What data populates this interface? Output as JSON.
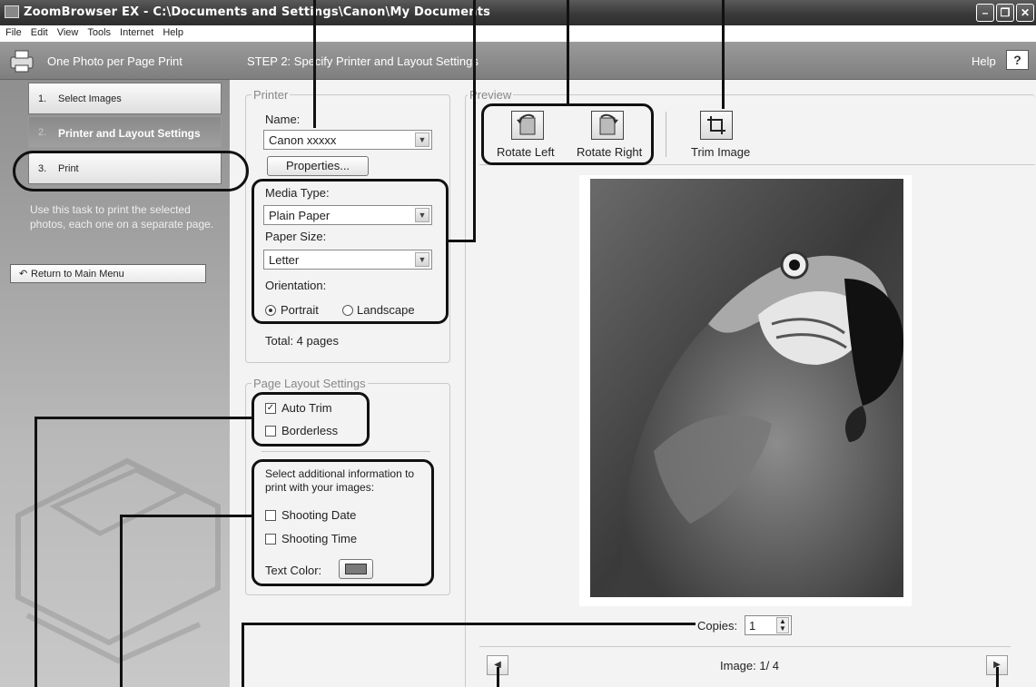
{
  "window": {
    "title": "ZoomBrowser EX  -  C:\\Documents and Settings\\Canon\\My Documents",
    "buttons": [
      "minimize",
      "restore",
      "close"
    ]
  },
  "menu": [
    "File",
    "Edit",
    "View",
    "Tools",
    "Internet",
    "Help"
  ],
  "header": {
    "task_title": "One Photo per Page Print",
    "step_title": "STEP 2: Specify Printer and Layout Settings",
    "help_label": "Help",
    "help_button": "?"
  },
  "sidebar": {
    "steps": [
      {
        "num": "1.",
        "label": "Select Images"
      },
      {
        "num": "2.",
        "label": "Printer and Layout Settings"
      },
      {
        "num": "3.",
        "label": "Print"
      }
    ],
    "description": "Use this task to print the selected photos, each one on a separate page.",
    "return_label": "Return to Main Menu"
  },
  "printer": {
    "legend": "Printer",
    "name_label": "Name:",
    "name_value": "Canon xxxxx",
    "properties_label": "Properties...",
    "media_label": "Media Type:",
    "media_value": "Plain Paper",
    "size_label": "Paper Size:",
    "size_value": "Letter",
    "orientation_label": "Orientation:",
    "portrait_label": "Portrait",
    "landscape_label": "Landscape",
    "orientation_selected": "Portrait",
    "total": "Total: 4 pages"
  },
  "layout": {
    "legend": "Page Layout Settings",
    "auto_trim_label": "Auto Trim",
    "auto_trim_checked": true,
    "borderless_label": "Borderless",
    "borderless_checked": false,
    "additional_info": "Select additional information to print with your images:",
    "shooting_date_label": "Shooting Date",
    "shooting_time_label": "Shooting Time",
    "text_color_label": "Text Color:",
    "text_color": "#7a7a7a"
  },
  "preview": {
    "legend": "Preview",
    "rotate_left_label": "Rotate Left",
    "rotate_right_label": "Rotate Right",
    "trim_label": "Trim Image",
    "copies_label": "Copies:",
    "copies_value": "1",
    "image_counter": "Image: 1/ 4"
  }
}
